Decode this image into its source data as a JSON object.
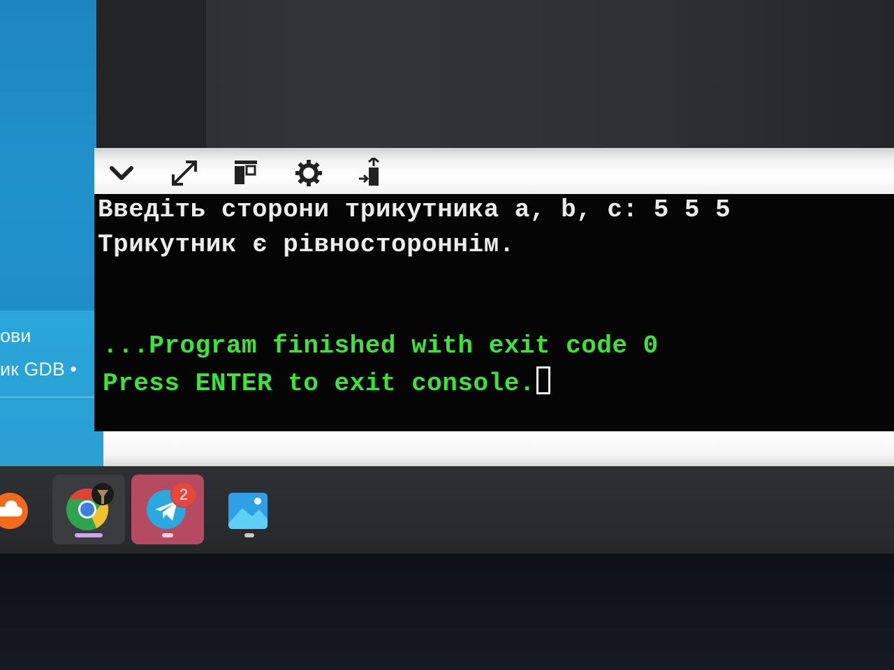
{
  "sidebar": {
    "items": [
      {
        "label": "ови"
      },
      {
        "label": "ик GDB •"
      }
    ]
  },
  "toolbar": {
    "icons": [
      "chevron-down-icon",
      "expand-icon",
      "layout-icon",
      "gear-icon",
      "upload-icon"
    ]
  },
  "terminal": {
    "lines": [
      "Введіть сторони трикутника a, b, c: 5 5 5",
      "Трикутник є рівностороннім."
    ],
    "status_lines": [
      "...Program finished with exit code 0",
      "Press ENTER to exit console."
    ],
    "text_color": "#ececec",
    "status_color": "#3ee23a"
  },
  "taskbar": {
    "apps": [
      {
        "name": "soundcloud-icon"
      },
      {
        "name": "chrome-icon"
      },
      {
        "name": "telegram-icon",
        "badge": "2"
      },
      {
        "name": "gallery-icon"
      }
    ]
  }
}
